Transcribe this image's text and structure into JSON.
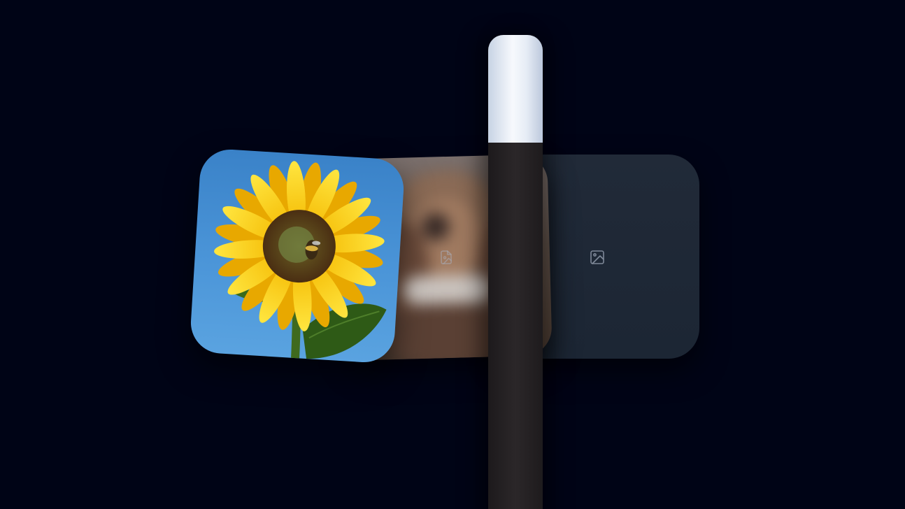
{
  "scene": {
    "background_color": "#000416",
    "cards": [
      {
        "id": "sunflower",
        "content": "sunflower-photo"
      },
      {
        "id": "dog-blurred",
        "content": "blurred-photo",
        "icon": "image-file-icon"
      },
      {
        "id": "empty",
        "content": "placeholder",
        "icon": "image-icon"
      }
    ],
    "wand": {
      "cap_color": "#eef2f8",
      "body_color": "#262224"
    }
  }
}
